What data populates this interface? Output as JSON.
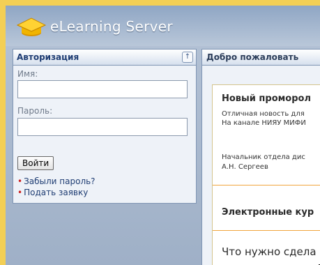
{
  "app": {
    "logo_text": "eLearning Server"
  },
  "auth": {
    "title": "Авторизация",
    "name_label": "Имя:",
    "name_value": "",
    "password_label": "Пароль:",
    "password_value": "",
    "login_button": "Войти",
    "forgot_link": "Забыли пароль?",
    "apply_link": "Подать заявку"
  },
  "main": {
    "welcome_title": "Добро пожаловать",
    "news_heading": "Новый проморол",
    "news_line1": "Отличная новость для",
    "news_line2": "На канале НИЯУ МИФИ",
    "news_line3": "Начальник отдела дис",
    "news_line4": "А.Н. Сергеев",
    "ecourses_heading": "Электронные кур",
    "what_todo": "Что нужно сдела"
  },
  "colors": {
    "page_bg": "#f3cf55",
    "frame_bg": "#9fb0c7",
    "accent_bullet": "#cc1e1e",
    "panel_border": "#7f95b4",
    "divider": "#f0a43d"
  },
  "icons": {
    "logo": "graduation-cap-icon",
    "collapse": "collapse-up-icon"
  }
}
